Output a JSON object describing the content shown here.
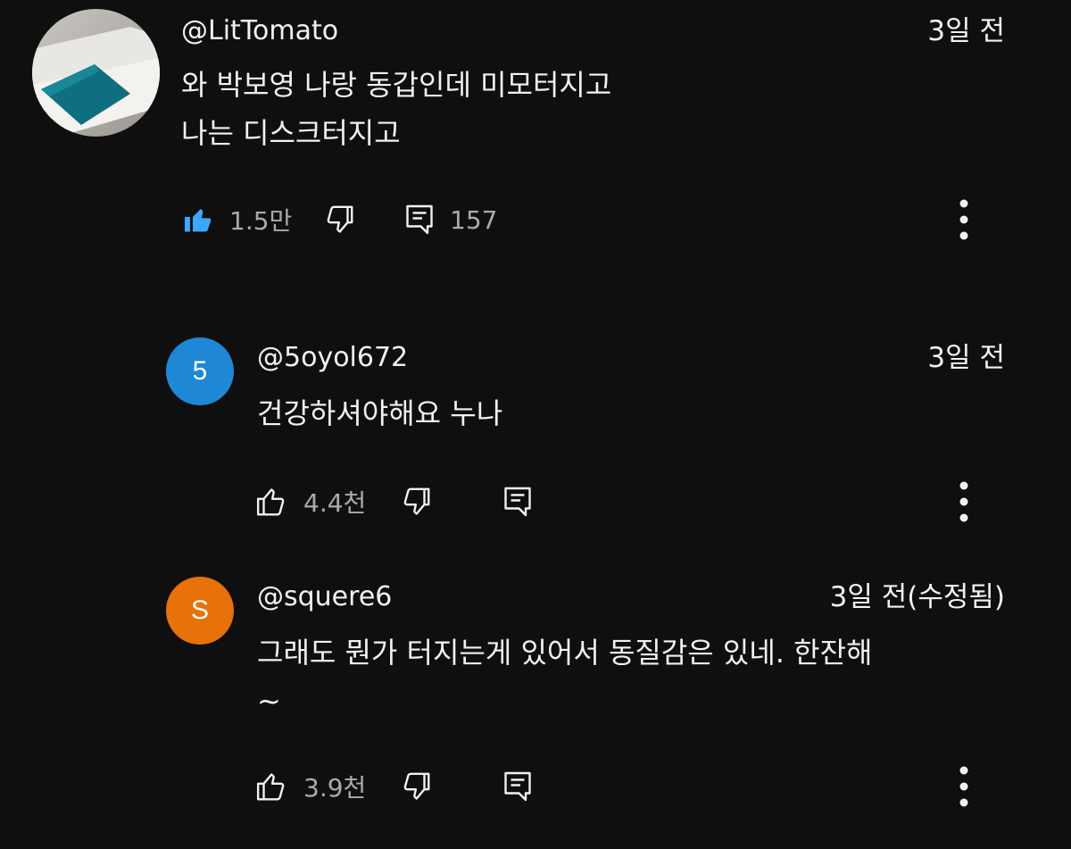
{
  "comments": [
    {
      "username": "@LitTomato",
      "timestamp": "3일 전",
      "lines": [
        "와 박보영 나랑 동갑인데 미모터지고",
        "나는 디스크터지고"
      ],
      "likes": "1.5만",
      "replies": "157",
      "liked": true
    },
    {
      "avatar_letter": "5",
      "avatar_color": "#1e88d6",
      "username": "@5oyol672",
      "timestamp": "3일 전",
      "lines": [
        "건강하셔야해요 누나"
      ],
      "likes": "4.4천"
    },
    {
      "avatar_letter": "S",
      "avatar_color": "#e8710a",
      "username": "@squere6",
      "timestamp": "3일 전(수정됨)",
      "lines": [
        "그래도 뭔가 터지는게 있어서 동질감은 있네. 한잔해",
        "~"
      ],
      "likes": "3.9천"
    }
  ],
  "colors": {
    "background": "#0f0f0f",
    "text": "#f1f1f1",
    "secondary_text": "#aaaaaa",
    "like_active": "#3ea6ff"
  },
  "icons": {
    "like": "thumbs-up-icon",
    "dislike": "thumbs-down-icon",
    "reply": "reply-comment-icon",
    "more": "more-vert-icon"
  }
}
